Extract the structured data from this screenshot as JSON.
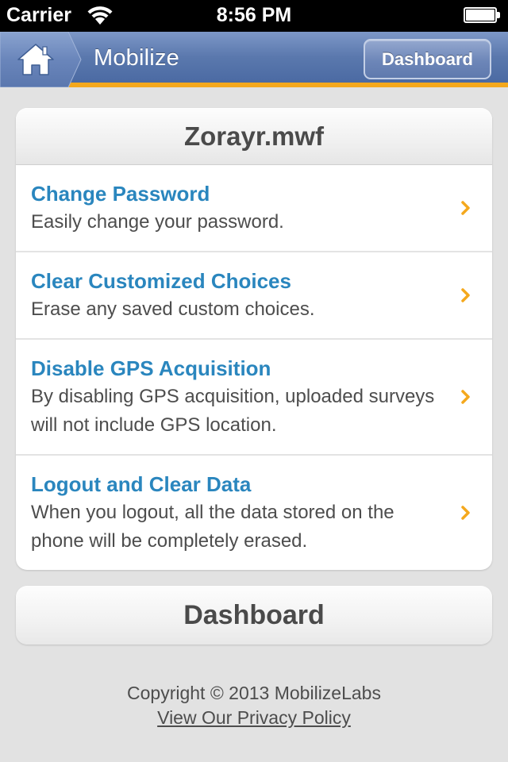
{
  "status_bar": {
    "carrier": "Carrier",
    "time": "8:56 PM"
  },
  "header": {
    "app_title": "Mobilize",
    "dashboard_button": "Dashboard",
    "accent_color": "#f4a81d",
    "bar_color": "#5a78ad"
  },
  "card": {
    "title": "Zorayr.mwf",
    "items": [
      {
        "title": "Change Password",
        "desc": "Easily change your password."
      },
      {
        "title": "Clear Customized Choices",
        "desc": "Erase any saved custom choices."
      },
      {
        "title": "Disable GPS Acquisition",
        "desc": "By disabling GPS acquisition, uploaded surveys will not include GPS location."
      },
      {
        "title": "Logout and Clear Data",
        "desc": "When you logout, all the data stored on the phone will be completely erased."
      }
    ]
  },
  "dashboard_button": "Dashboard",
  "footer": {
    "copyright": "Copyright © 2013 MobilizeLabs",
    "privacy_link": "View Our Privacy Policy"
  },
  "icons": {
    "home": "home-icon",
    "wifi": "wifi-icon",
    "battery": "battery-icon",
    "chevron": "chevron-right-icon"
  }
}
